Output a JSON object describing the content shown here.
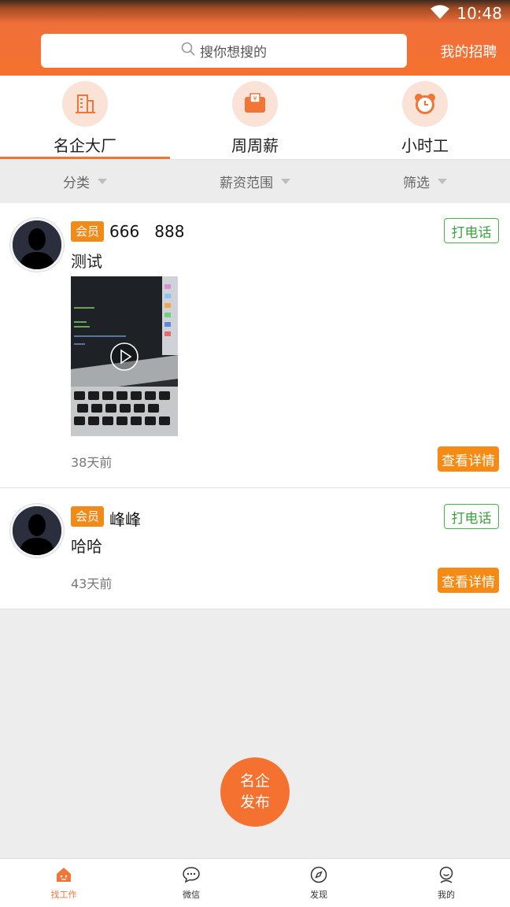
{
  "status": {
    "time": "10:48",
    "wifi_icon": "wifi-icon"
  },
  "header": {
    "search_placeholder": "搜你想搜的",
    "my_recruit": "我的招聘"
  },
  "tabs": [
    {
      "label": "名企大厂",
      "icon": "building-icon",
      "active": true
    },
    {
      "label": "周周薪",
      "icon": "salary-calendar-icon",
      "active": false
    },
    {
      "label": "小时工",
      "icon": "alarm-clock-icon",
      "active": false
    }
  ],
  "filters": [
    {
      "label": "分类"
    },
    {
      "label": "薪资范围"
    },
    {
      "label": "筛选"
    }
  ],
  "posts": [
    {
      "badge": "会员",
      "name": "666   888",
      "desc": "测试",
      "time": "38天前",
      "call": "打电话",
      "detail": "查看详情",
      "has_video": true
    },
    {
      "badge": "会员",
      "name": "峰峰",
      "desc": "哈哈",
      "time": "43天前",
      "call": "打电话",
      "detail": "查看详情",
      "has_video": false
    }
  ],
  "fab": {
    "line1": "名企",
    "line2": "发布"
  },
  "bottom_nav": [
    {
      "label": "找工作",
      "icon": "home-icon",
      "active": true
    },
    {
      "label": "微信",
      "icon": "chat-bubble-icon",
      "active": false
    },
    {
      "label": "发现",
      "icon": "compass-icon",
      "active": false
    },
    {
      "label": "我的",
      "icon": "profile-icon",
      "active": false
    }
  ],
  "colors": {
    "brand": "#f5712f",
    "detail_button": "#f58a14",
    "call_border": "#46b34a"
  }
}
